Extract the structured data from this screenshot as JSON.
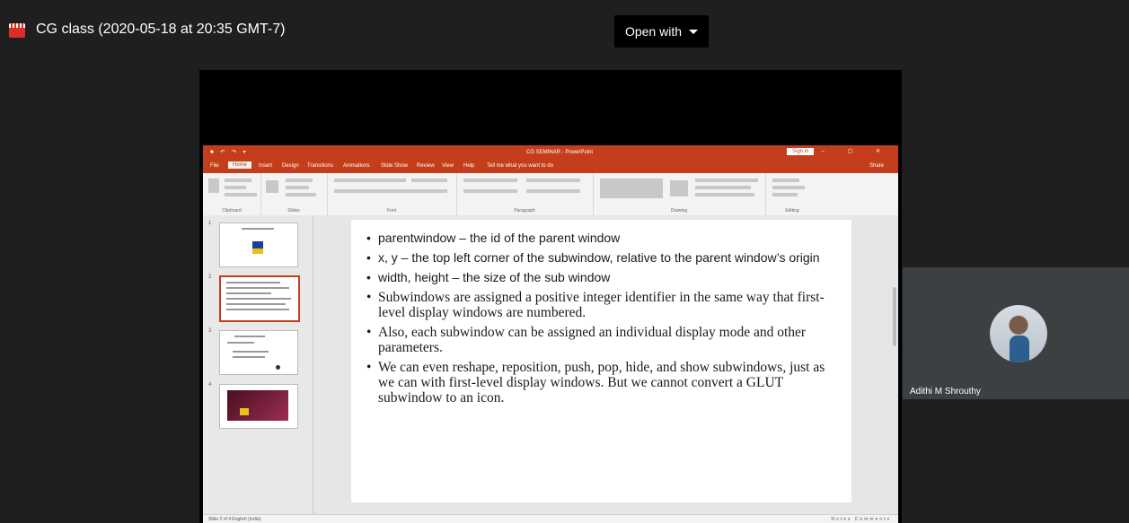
{
  "header": {
    "title": "CG class (2020-05-18 at 20:35 GMT-7)",
    "open_with_label": "Open with"
  },
  "ppt": {
    "doc_title": "CG SEMINAR - PowerPoint",
    "sign_in": "Sign in",
    "tabs": [
      "File",
      "Home",
      "Insert",
      "Design",
      "Transitions",
      "Animations",
      "Slide Show",
      "Review",
      "View",
      "Help",
      "Tell me what you want to do"
    ],
    "share": "Share",
    "ribbon_groups": [
      "Clipboard",
      "Slides",
      "Font",
      "Paragraph",
      "Drawing",
      "Editing"
    ],
    "slide_numbers": [
      "1",
      "2",
      "3",
      "4"
    ],
    "status_left": "Slide 2 of 4    English (India)",
    "status_right": "Notes  Comments",
    "slide": {
      "bullets": [
        "parentwindow – the id of the parent window",
        "x, y – the top left corner of the subwindow, relative to the parent window’s origin",
        "width, height – the size of the sub window",
        "Subwindows are assigned a positive integer identifier in the same way that first-level display windows are numbered.",
        "Also, each subwindow can be assigned an individual display mode and other parameters.",
        " We can even reshape, reposition, push, pop, hide, and show subwindows, just as we can with first-level display windows. But we cannot convert a GLUT subwindow to an icon."
      ]
    }
  },
  "participant": {
    "name": "Adithi M Shrouthy"
  },
  "colors": {
    "ppt_accent": "#c43e1c",
    "background": "#1f1f1f"
  },
  "icons": {
    "file": "video-file-icon",
    "dropdown": "caret-down-icon"
  }
}
